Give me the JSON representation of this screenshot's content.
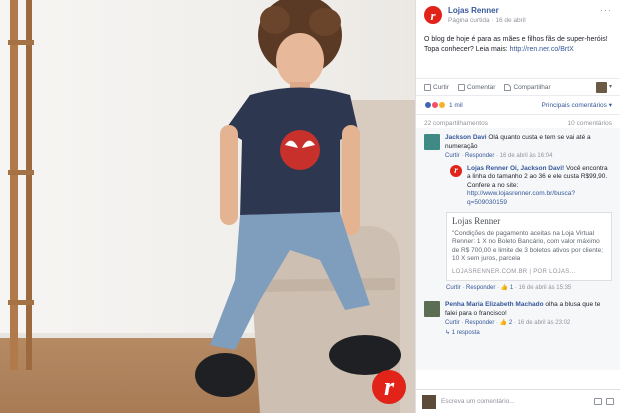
{
  "page": {
    "name": "Lojas Renner",
    "meta_type": "Página curtida",
    "meta_sep": " · ",
    "meta_date": "16 de abril",
    "post_text": "O blog de hoje é para as mães e filhos fãs de super-heróis! Topa conhecer? Leia mais: ",
    "post_link": "http://ren.ner.co/BrtX"
  },
  "actions": {
    "like": "Curtir",
    "comment": "Comentar",
    "share": "Compartilhar"
  },
  "reactions": {
    "count": "1 mil",
    "relevant": "Principais comentários"
  },
  "counts": {
    "shares": "22 compartilhamentos",
    "comments": "10 comentários"
  },
  "comments": [
    {
      "name": "Jackson Davi",
      "text": " Olá quanto custa e tem se vai até a numeração",
      "like": "Curtir",
      "reply": "Responder",
      "date": "16 de abril às 16:04"
    }
  ],
  "reply": {
    "name": "Lojas Renner",
    "tag": "Oi, Jackson Davi!",
    "text": " Você encontra a linha do tamanho 2 ao 36 e ele custa R$99,90. Confere a no site: ",
    "link": "http://www.lojasrenner.com.br/busca?q=509030159",
    "preview_title": "Lojas Renner",
    "preview_text": "\"Condições de pagamento aceitas na Loja Virtual Renner: 1 X no Boleto Bancário, com valor máximo de R$ 700,00 e limite de 3 boletos ativos por cliente; 10 X sem juros, parcela",
    "preview_host": "LOJASRENNER.COM.BR  |  POR LOJAS...",
    "like": "Curtir",
    "reply_label": "Responder",
    "likes": "1",
    "date": "16 de abril às 15:35"
  },
  "comment2": {
    "name": "Penha Maria Elizabeth Machado",
    "text": " olha a blusa que te falei para o francisco!",
    "like": "Curtir",
    "reply": "Responder",
    "likes": "2",
    "date": "16 de abril às 23:02",
    "replies": "1 resposta"
  },
  "write": {
    "placeholder": "Escreva um comentário..."
  },
  "colors": {
    "brand": "#e1231a",
    "link": "#365899"
  }
}
